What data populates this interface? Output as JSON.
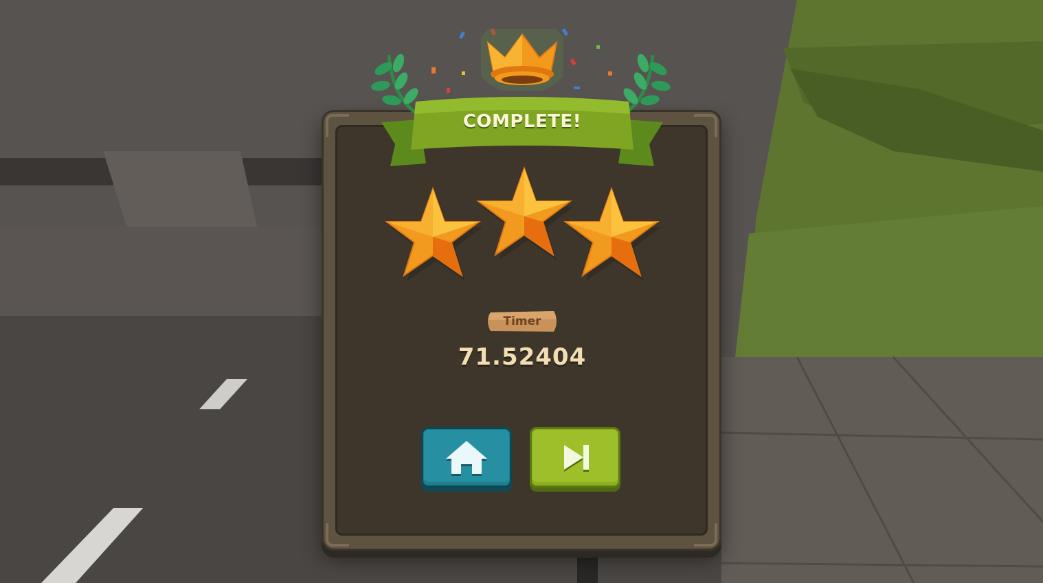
{
  "result": {
    "title": "COMPLETE!",
    "stars_earned": 3,
    "stars_total": 3
  },
  "timer": {
    "label": "Timer",
    "value": "71.52404"
  },
  "buttons": {
    "home_icon": "home-icon",
    "next_icon": "skip-next-icon"
  },
  "colors": {
    "banner": "#7fa522",
    "panel": "#3e362b",
    "star": "#f7a21a",
    "home_button": "#1f7f91",
    "next_button": "#8eb122",
    "timer_text": "#f2deb2"
  }
}
